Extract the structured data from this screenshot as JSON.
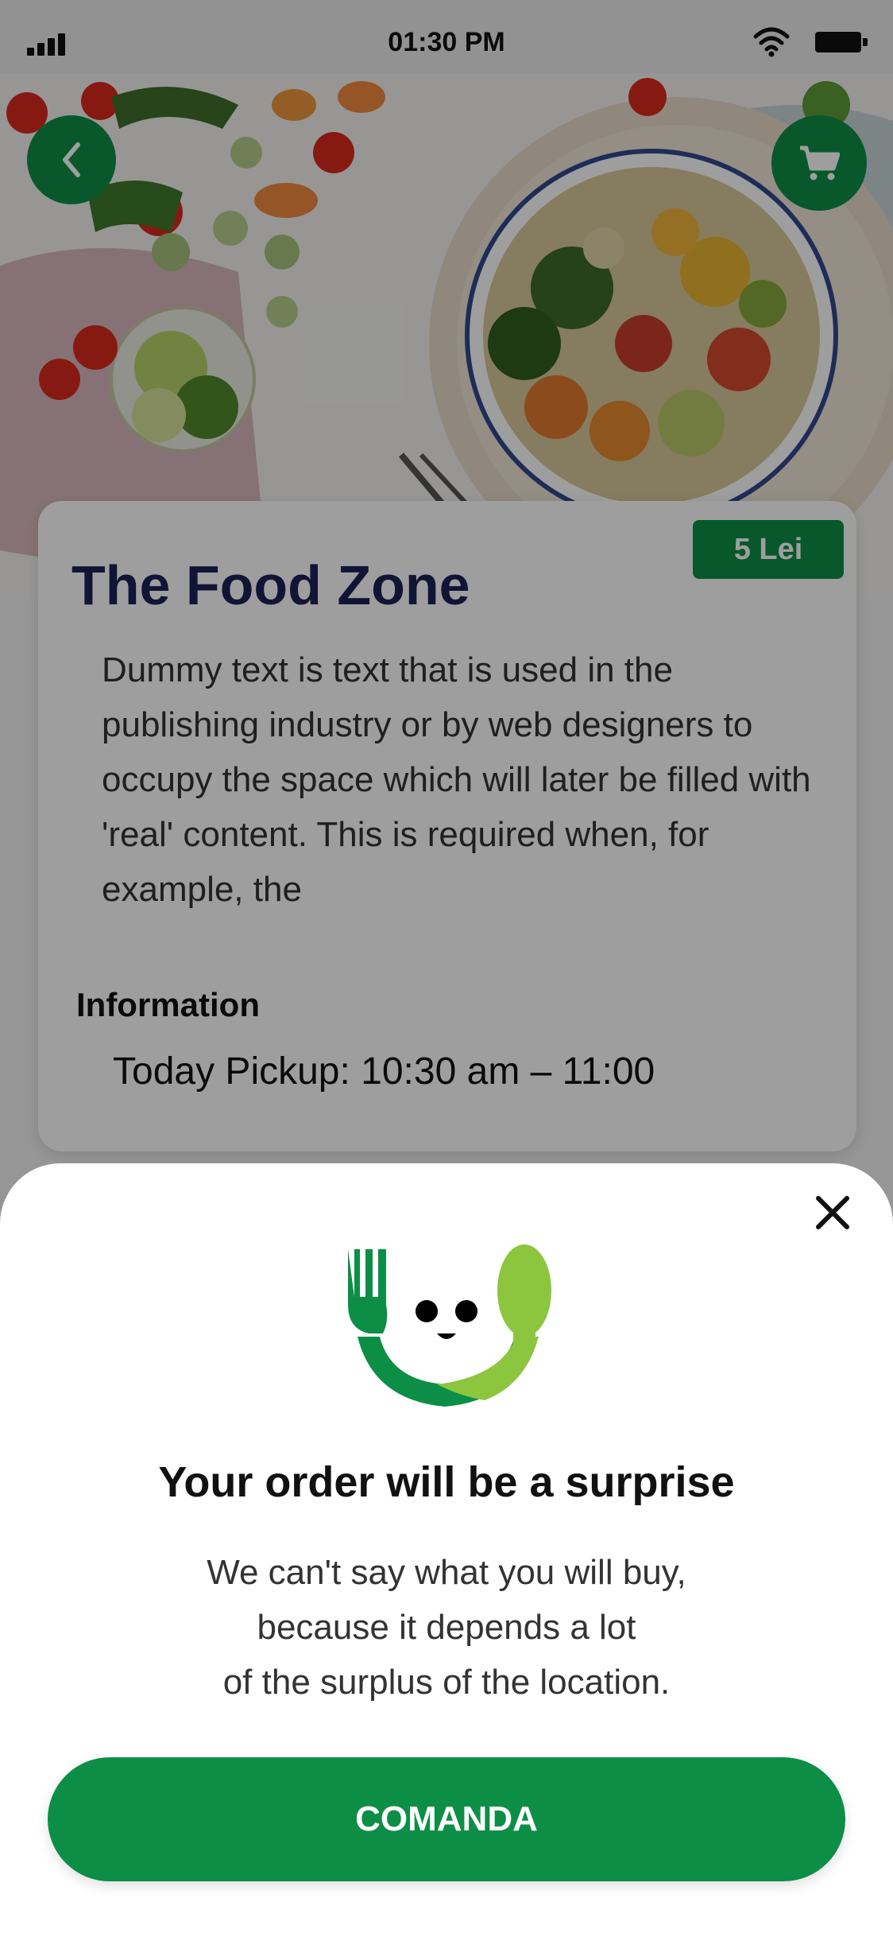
{
  "status_bar": {
    "time": "01:30 PM"
  },
  "icons": {
    "back": "chevron-left-icon",
    "cart": "shopping-cart-icon",
    "close": "close-icon",
    "logo": "fork-spoon-smile-logo"
  },
  "restaurant": {
    "price": "5 Lei",
    "name": "The Food Zone",
    "description": "Dummy text is text that is used in the publishing industry or by web designers to occupy the space which will later be filled with 'real' content. This is required when, for example, the",
    "info_label": "Information",
    "pickup": "Today Pickup: 10:30 am – 11:00"
  },
  "modal": {
    "title": "Your order will be a surprise",
    "body_lines": [
      "We can't say what you will buy,",
      "because it depends a lot",
      "of the surplus of the location."
    ],
    "button_label": "COMANDA"
  },
  "colors": {
    "primary_green": "#0d8e46",
    "logo_light_green": "#8cc63f",
    "title_navy": "#1e2157"
  }
}
